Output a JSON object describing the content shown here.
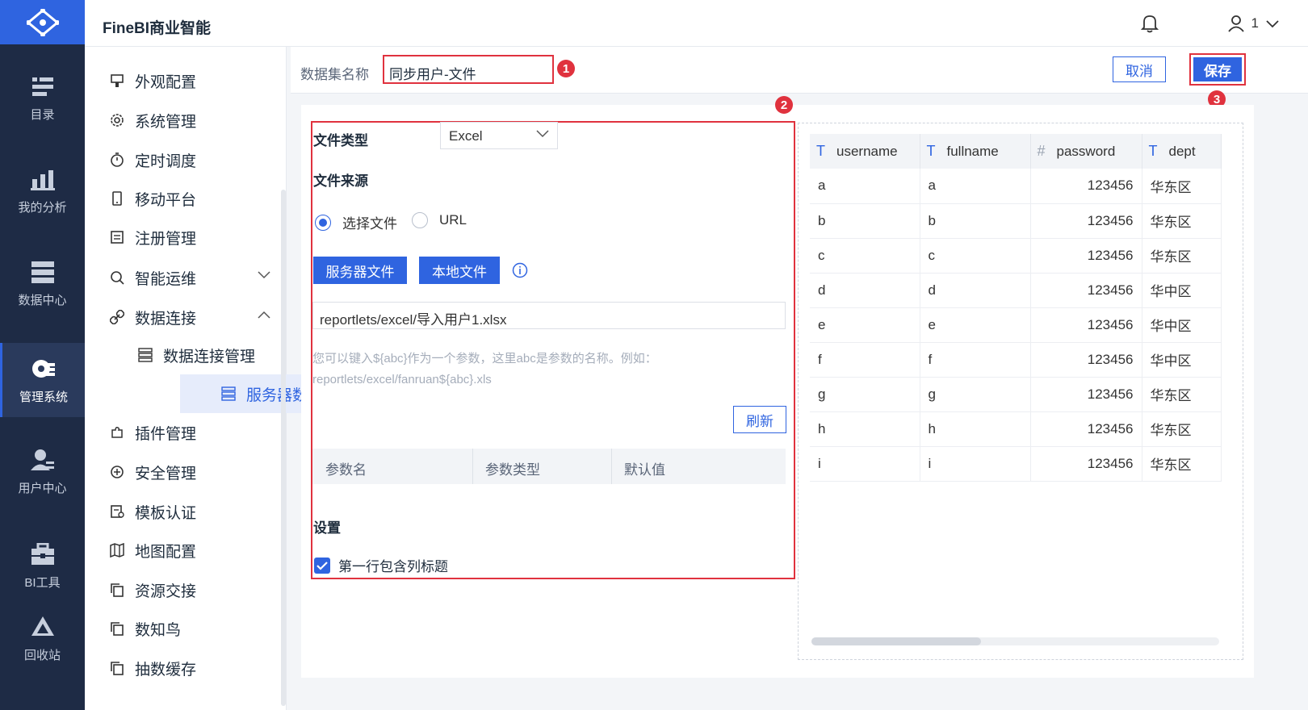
{
  "app": {
    "title": "FineBI商业智能"
  },
  "header": {
    "user_label": "1"
  },
  "nav": [
    {
      "label": "目录",
      "icon": "catalog-icon"
    },
    {
      "label": "我的分析",
      "icon": "analysis-icon"
    },
    {
      "label": "数据中心",
      "icon": "data-center-icon"
    },
    {
      "label": "管理系统",
      "icon": "management-icon"
    },
    {
      "label": "用户中心",
      "icon": "user-center-icon"
    },
    {
      "label": "BI工具",
      "icon": "toolbox-icon"
    },
    {
      "label": "回收站",
      "icon": "recycle-icon"
    }
  ],
  "submenu": {
    "items": [
      {
        "label": "外观配置"
      },
      {
        "label": "系统管理"
      },
      {
        "label": "定时调度"
      },
      {
        "label": "移动平台"
      },
      {
        "label": "注册管理"
      },
      {
        "label": "智能运维"
      },
      {
        "label": "数据连接"
      },
      {
        "label": "插件管理"
      },
      {
        "label": "安全管理"
      },
      {
        "label": "模板认证"
      },
      {
        "label": "地图配置"
      },
      {
        "label": "资源交接"
      },
      {
        "label": "数知鸟"
      },
      {
        "label": "抽数缓存"
      }
    ],
    "sub_items": [
      {
        "label": "数据连接管理"
      },
      {
        "label": "服务器数据集"
      }
    ]
  },
  "dataset": {
    "name_label": "数据集名称",
    "name_value": "同步用户-文件",
    "cancel_label": "取消",
    "save_label": "保存"
  },
  "badges": [
    "1",
    "2",
    "3"
  ],
  "form": {
    "file_type_label": "文件类型",
    "file_type_value": "Excel",
    "file_source_label": "文件来源",
    "radio_choose_file": "选择文件",
    "radio_url": "URL",
    "server_file_btn": "服务器文件",
    "local_file_btn": "本地文件",
    "path_value": "reportlets/excel/导入用户1.xlsx",
    "hint_line1": "您可以键入${abc}作为一个参数，这里abc是参数的名称。例如：",
    "hint_line2": "reportlets/excel/fanruan${abc}.xls",
    "refresh_btn": "刷新",
    "param_headers": [
      "参数名",
      "参数类型",
      "默认值"
    ],
    "settings_label": "设置",
    "first_row_header_label": "第一行包含列标题",
    "first_row_header_checked": true
  },
  "preview": {
    "columns": [
      {
        "name": "username",
        "type": "text"
      },
      {
        "name": "fullname",
        "type": "text"
      },
      {
        "name": "password",
        "type": "number"
      },
      {
        "name": "dept",
        "type": "text"
      }
    ],
    "rows": [
      [
        "a",
        "a",
        "123456",
        "华东区"
      ],
      [
        "b",
        "b",
        "123456",
        "华东区"
      ],
      [
        "c",
        "c",
        "123456",
        "华东区"
      ],
      [
        "d",
        "d",
        "123456",
        "华中区"
      ],
      [
        "e",
        "e",
        "123456",
        "华中区"
      ],
      [
        "f",
        "f",
        "123456",
        "华中区"
      ],
      [
        "g",
        "g",
        "123456",
        "华东区"
      ],
      [
        "h",
        "h",
        "123456",
        "华东区"
      ],
      [
        "i",
        "i",
        "123456",
        "华东区"
      ]
    ]
  }
}
